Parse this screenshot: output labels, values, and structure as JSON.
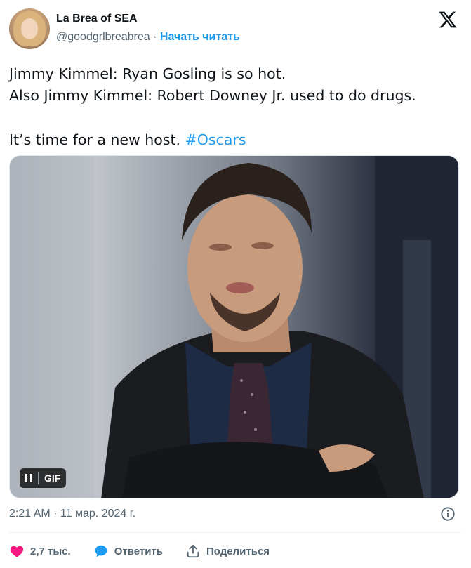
{
  "author": {
    "name": "La Brea of SEA",
    "handle": "@goodgrlbreabrea",
    "separator": "·",
    "follow_label": "Начать читать"
  },
  "tweet": {
    "line1": "Jimmy Kimmel: Ryan Gosling is so hot.",
    "line2": "Also Jimmy Kimmel: Robert Downey Jr. used to do drugs.",
    "line3_prefix": "It’s time for a new host. ",
    "hashtag": "#Oscars"
  },
  "media": {
    "badge_label": "GIF"
  },
  "meta": {
    "timestamp": "2:21 AM · 11 мар. 2024 г."
  },
  "actions": {
    "like_count": "2,7 тыс.",
    "reply_label": "Ответить",
    "share_label": "Поделиться"
  },
  "colors": {
    "accent": "#1d9bf0",
    "like": "#f91880",
    "text": "#0f1419",
    "secondary": "#536471"
  },
  "icons": {
    "brand": "x-logo-icon",
    "info": "info-icon",
    "like": "heart-icon",
    "reply": "reply-bubble-icon",
    "share": "share-icon",
    "pause": "pause-icon"
  }
}
